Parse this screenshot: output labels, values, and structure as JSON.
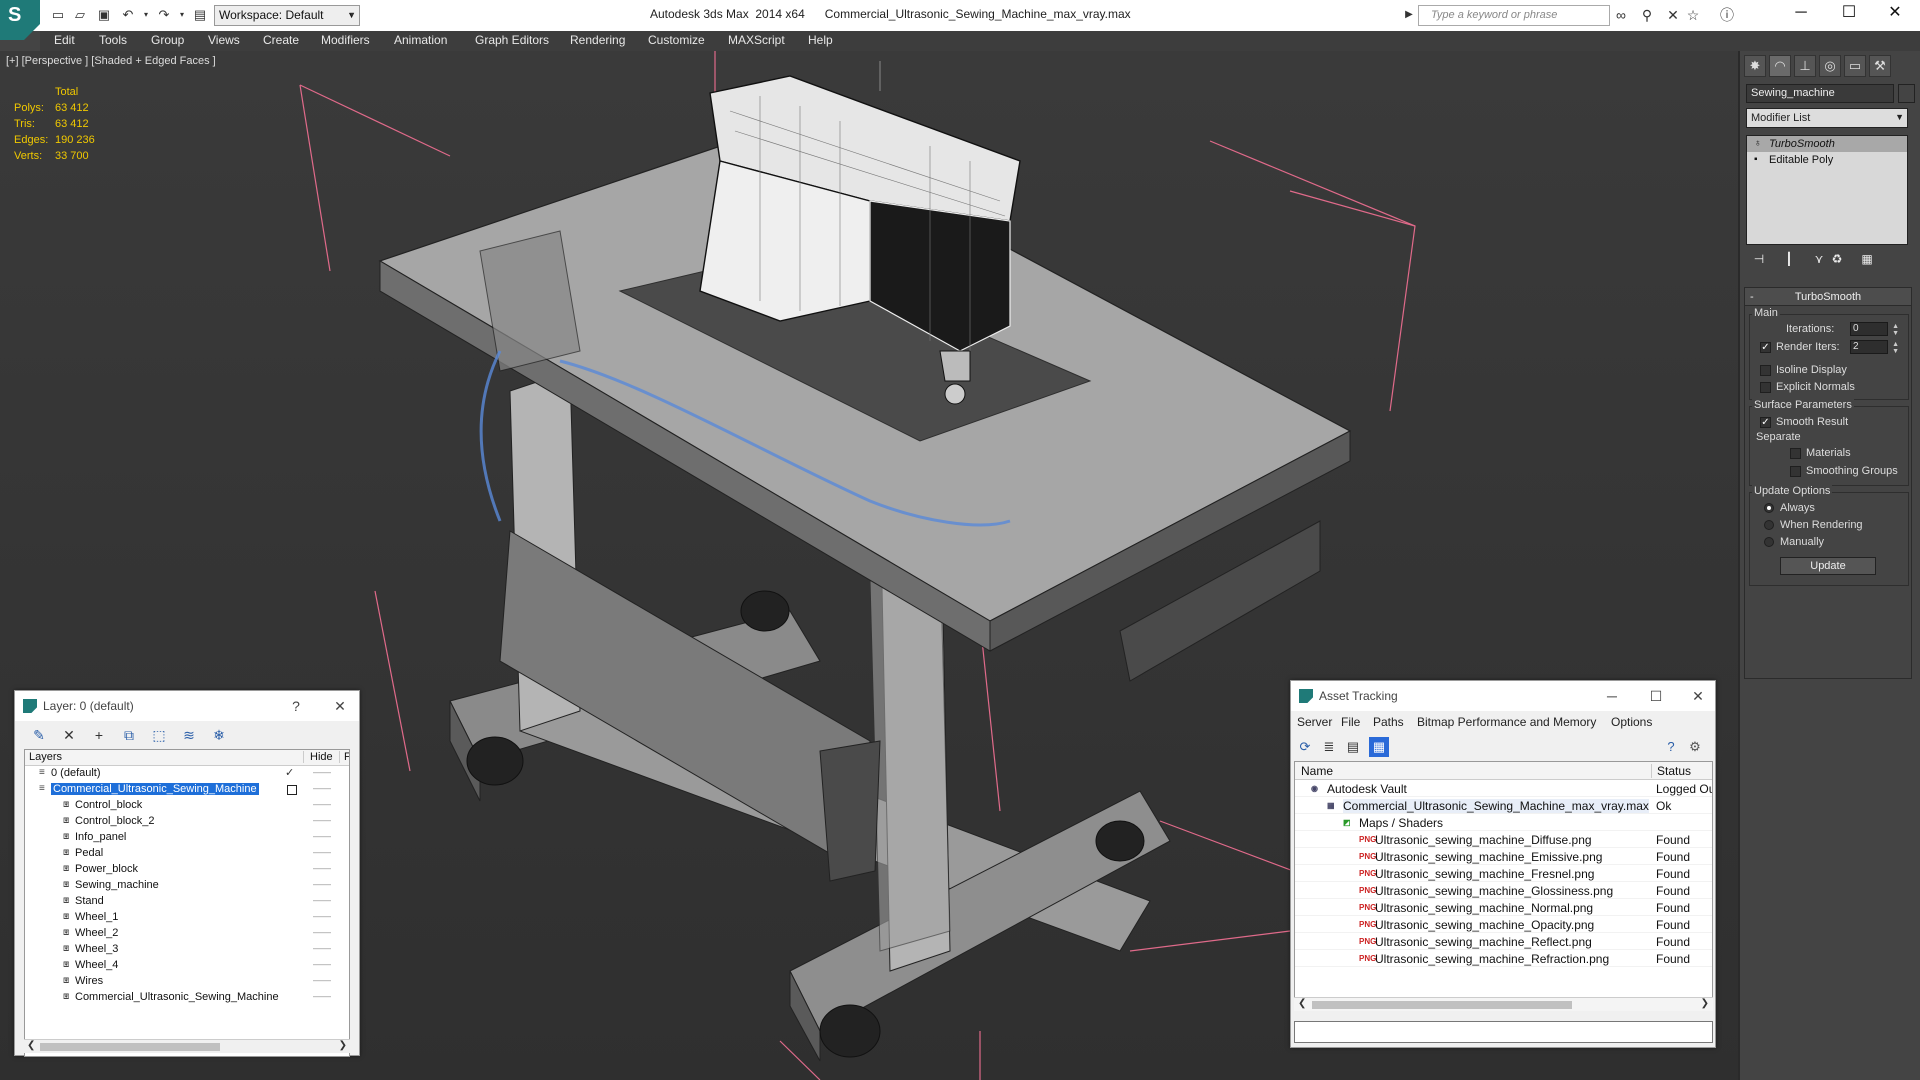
{
  "app": {
    "title": "Autodesk 3ds Max  2014 x64      Commercial_Ultrasonic_Sewing_Machine_max_vray.max",
    "workspace": "Workspace: Default",
    "search_placeholder": "Type a keyword or phrase"
  },
  "menu": [
    "Edit",
    "Tools",
    "Group",
    "Views",
    "Create",
    "Modifiers",
    "Animation",
    "Graph Editors",
    "Rendering",
    "Customize",
    "MAXScript",
    "Help"
  ],
  "viewport": {
    "label": "[+] [Perspective ] [Shaded + Edged Faces ]",
    "stats": {
      "header": "Total",
      "rows": [
        {
          "k": "Polys:",
          "v": "63 412"
        },
        {
          "k": "Tris:",
          "v": "63 412"
        },
        {
          "k": "Edges:",
          "v": "190 236"
        },
        {
          "k": "Verts:",
          "v": "33 700"
        }
      ]
    }
  },
  "command_panel": {
    "object_name": "Sewing_machine",
    "modifier_list": "Modifier List",
    "stack": [
      "TurboSmooth",
      "Editable Poly"
    ],
    "turbosmooth": {
      "title": "TurboSmooth",
      "main": "Main",
      "iterations_label": "Iterations:",
      "iterations": "0",
      "render_iters_label": "Render Iters:",
      "render_iters": "2",
      "isoline": "Isoline Display",
      "explicit_normals": "Explicit Normals",
      "surface_params": "Surface Parameters",
      "smooth_result": "Smooth Result",
      "separate": "Separate",
      "materials": "Materials",
      "smoothing_groups": "Smoothing Groups",
      "update_options": "Update Options",
      "always": "Always",
      "when_rendering": "When Rendering",
      "manually": "Manually",
      "update": "Update"
    }
  },
  "layer_panel": {
    "title": "Layer: 0 (default)",
    "help": "?",
    "col_layers": "Layers",
    "col_hide": "Hide",
    "col_fr": "Fr",
    "rows": [
      {
        "name": "0 (default)",
        "level": 0,
        "kind": "layer"
      },
      {
        "name": "Commercial_Ultrasonic_Sewing_Machine",
        "level": 0,
        "kind": "layer",
        "selected": true
      },
      {
        "name": "Control_block",
        "level": 1,
        "kind": "obj"
      },
      {
        "name": "Control_block_2",
        "level": 1,
        "kind": "obj"
      },
      {
        "name": "Info_panel",
        "level": 1,
        "kind": "obj"
      },
      {
        "name": "Pedal",
        "level": 1,
        "kind": "obj"
      },
      {
        "name": "Power_block",
        "level": 1,
        "kind": "obj"
      },
      {
        "name": "Sewing_machine",
        "level": 1,
        "kind": "obj"
      },
      {
        "name": "Stand",
        "level": 1,
        "kind": "obj"
      },
      {
        "name": "Wheel_1",
        "level": 1,
        "kind": "obj"
      },
      {
        "name": "Wheel_2",
        "level": 1,
        "kind": "obj"
      },
      {
        "name": "Wheel_3",
        "level": 1,
        "kind": "obj"
      },
      {
        "name": "Wheel_4",
        "level": 1,
        "kind": "obj"
      },
      {
        "name": "Wires",
        "level": 1,
        "kind": "obj"
      },
      {
        "name": "Commercial_Ultrasonic_Sewing_Machine",
        "level": 1,
        "kind": "obj"
      }
    ]
  },
  "asset_panel": {
    "title": "Asset Tracking",
    "menu": [
      "Server",
      "File",
      "Paths",
      "Bitmap Performance and Memory",
      "Options"
    ],
    "col_name": "Name",
    "col_status": "Status",
    "rows": [
      {
        "name": "Autodesk Vault",
        "status": "Logged Ou",
        "level": 0,
        "icon": "vault"
      },
      {
        "name": "Commercial_Ultrasonic_Sewing_Machine_max_vray.max",
        "status": "Ok",
        "level": 1,
        "icon": "max"
      },
      {
        "name": "Maps / Shaders",
        "status": "",
        "level": 2,
        "icon": "maps"
      },
      {
        "name": "Ultrasonic_sewing_machine_Diffuse.png",
        "status": "Found",
        "level": 3,
        "icon": "png"
      },
      {
        "name": "Ultrasonic_sewing_machine_Emissive.png",
        "status": "Found",
        "level": 3,
        "icon": "png"
      },
      {
        "name": "Ultrasonic_sewing_machine_Fresnel.png",
        "status": "Found",
        "level": 3,
        "icon": "png"
      },
      {
        "name": "Ultrasonic_sewing_machine_Glossiness.png",
        "status": "Found",
        "level": 3,
        "icon": "png"
      },
      {
        "name": "Ultrasonic_sewing_machine_Normal.png",
        "status": "Found",
        "level": 3,
        "icon": "png"
      },
      {
        "name": "Ultrasonic_sewing_machine_Opacity.png",
        "status": "Found",
        "level": 3,
        "icon": "png"
      },
      {
        "name": "Ultrasonic_sewing_machine_Reflect.png",
        "status": "Found",
        "level": 3,
        "icon": "png"
      },
      {
        "name": "Ultrasonic_sewing_machine_Refraction.png",
        "status": "Found",
        "level": 3,
        "icon": "png"
      }
    ]
  },
  "icon_glyphs": {
    "png": "PNG",
    "max": "▦",
    "maps": "◩",
    "vault": "◉"
  }
}
